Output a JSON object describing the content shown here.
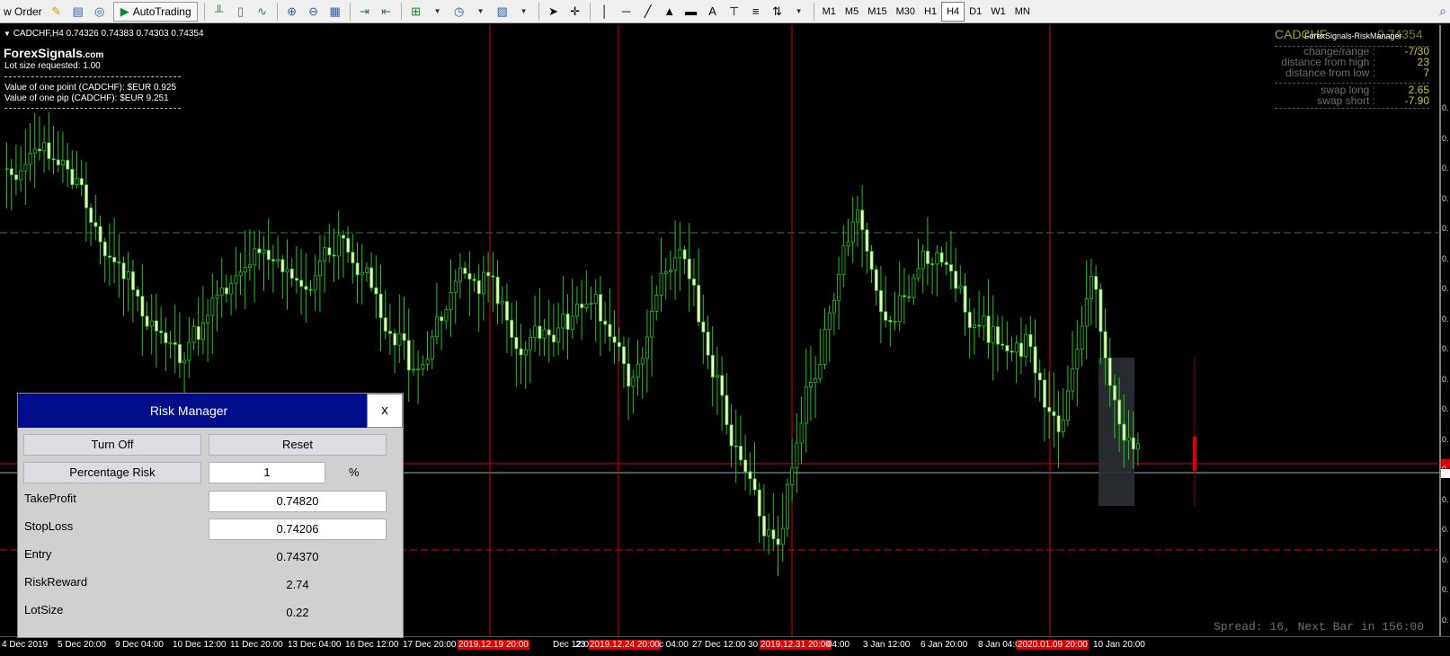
{
  "toolbar": {
    "new_order": "w Order",
    "autotrading": "AutoTrading",
    "timeframes": [
      "M1",
      "M5",
      "M15",
      "M30",
      "H1",
      "H4",
      "D1",
      "W1",
      "MN"
    ],
    "active_timeframe": "H4"
  },
  "chart": {
    "symbol_line": "CADCHF,H4  0.74326 0.74383 0.74303 0.74354",
    "logo_main": "ForexSignals",
    "logo_suffix": ".com",
    "lot_size_requested": "Lot size requested: 1.00",
    "point_value": "Value of one point (CADCHF):  $EUR 0.925",
    "pip_value": "Value of one pip    (CADCHF):  $EUR 9.251",
    "indicator_name": "ForexSignals-RiskManager",
    "symbol_big": "CADCHF",
    "price_big": "0.74354",
    "stats": [
      {
        "label": "change/range :",
        "value": "-7/30"
      },
      {
        "label": "distance from high :",
        "value": "23"
      },
      {
        "label": "distance from low :",
        "value": "7"
      },
      {
        "label": "swap long :",
        "value": "2.65"
      },
      {
        "label": "swap short :",
        "value": "-7.90"
      }
    ],
    "spread_text": "Spread: 16, Next Bar in 156:00",
    "y_axis_labels": [
      "0.",
      "0.",
      "0.",
      "0.",
      "0.",
      "0.",
      "0.",
      "0.",
      "0.",
      "0.",
      "0.",
      "0.",
      "0.",
      "0.",
      "0.",
      "0.",
      "0.",
      "0."
    ],
    "time_labels": [
      {
        "text": "4 Dec 2019",
        "hl": false
      },
      {
        "text": "5 Dec 20:00",
        "hl": false
      },
      {
        "text": "9 Dec 04:00",
        "hl": false
      },
      {
        "text": "10 Dec 12:00",
        "hl": false
      },
      {
        "text": "11 Dec 20:00",
        "hl": false
      },
      {
        "text": "13 Dec 04:00",
        "hl": false
      },
      {
        "text": "16 Dec 12:00",
        "hl": false
      },
      {
        "text": "17 Dec 20:00",
        "hl": false
      },
      {
        "text": "2019.12.19 20:00",
        "hl": true
      },
      {
        "text": "Dec 12:00",
        "hl": false
      },
      {
        "text": "23",
        "hl": false
      },
      {
        "text": "2019.12.24 20:00",
        "hl": true
      },
      {
        "text": "c 04:00",
        "hl": false
      },
      {
        "text": "27 Dec 12:00",
        "hl": false
      },
      {
        "text": "30",
        "hl": false
      },
      {
        "text": "2019.12.31 20:00",
        "hl": true
      },
      {
        "text": "04:00",
        "hl": false
      },
      {
        "text": "3 Jan 12:00",
        "hl": false
      },
      {
        "text": "6 Jan 20:00",
        "hl": false
      },
      {
        "text": "8 Jan 04:00",
        "hl": false
      },
      {
        "text": "2020.01.09 20:00",
        "hl": true
      },
      {
        "text": "10 Jan 20:00",
        "hl": false
      }
    ]
  },
  "risk_manager": {
    "title": "Risk Manager",
    "close_label": "x",
    "turn_off_label": "Turn Off",
    "reset_label": "Reset",
    "percentage_risk_label": "Percentage Risk",
    "risk_value": "1",
    "risk_unit": "%",
    "take_profit_label": "TakeProfit",
    "take_profit_value": "0.74820",
    "stop_loss_label": "StopLoss",
    "stop_loss_value": "0.74206",
    "entry_label": "Entry",
    "entry_value": "0.74370",
    "risk_reward_label": "RiskReward",
    "risk_reward_value": "2.74",
    "lot_size_label": "LotSize",
    "lot_size_value": "0.22"
  }
}
